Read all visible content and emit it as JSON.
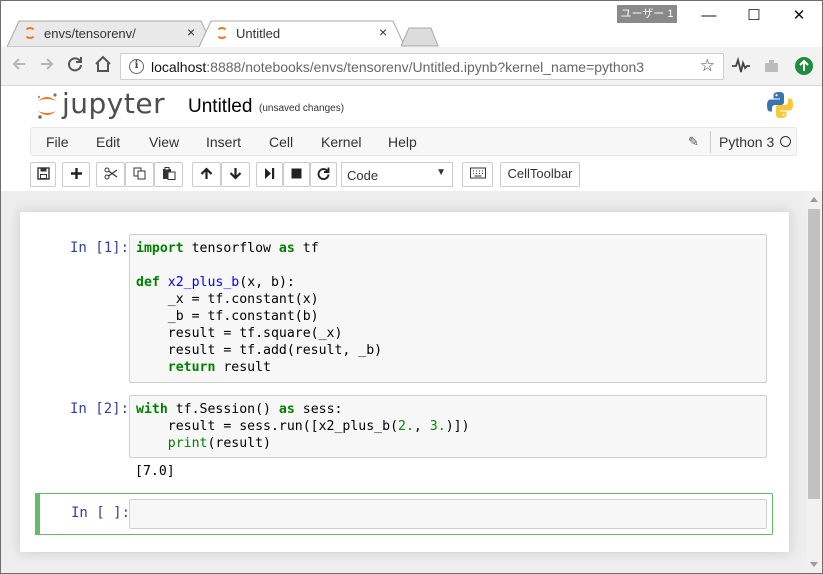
{
  "browser": {
    "tabs": [
      {
        "label": "envs/tensorenv/",
        "close": "×"
      },
      {
        "label": "Untitled",
        "close": "×"
      }
    ],
    "user_badge": "ユーザー 1",
    "window_controls": {
      "minimize": "—",
      "maximize": "☐",
      "close": "✕"
    },
    "address": {
      "host": "localhost",
      "rest": ":8888/notebooks/envs/tensorenv/Untitled.ipynb?kernel_name=python3"
    }
  },
  "jupyter": {
    "wordmark": "jupyter",
    "notebook_title": "Untitled",
    "save_status": "(unsaved changes)",
    "menu": [
      "File",
      "Edit",
      "View",
      "Insert",
      "Cell",
      "Kernel",
      "Help"
    ],
    "kernel_name": "Python 3",
    "toolbar": {
      "cell_type": "Code",
      "celltoolbar_label": "CellToolbar"
    }
  },
  "cells": [
    {
      "prompt": "In [1]:"
    },
    {
      "prompt": "In [2]:",
      "output": "[7.0]"
    },
    {
      "prompt": "In [ ]:"
    }
  ],
  "code_text": {
    "c1_l1_a": "import",
    "c1_l1_b": " tensorflow ",
    "c1_l1_c": "as",
    "c1_l1_d": " tf",
    "c1_l3_a": "def",
    "c1_l3_b": "x2_plus_b",
    "c1_l3_c": "(x, b):",
    "c1_l4": "    _x = tf.constant(x)",
    "c1_l5": "    _b = tf.constant(b)",
    "c1_l6": "    result = tf.square(_x)",
    "c1_l7": "    result = tf.add(result, _b)",
    "c1_l8_a": "return",
    "c1_l8_b": " result",
    "c2_l1_a": "with",
    "c2_l1_b": " tf.Session() ",
    "c2_l1_c": "as",
    "c2_l1_d": " sess:",
    "c2_l2_a": "    result = sess.run([x2_plus_b(",
    "c2_l2_b": "2.",
    "c2_l2_c": ", ",
    "c2_l2_d": "3.",
    "c2_l2_e": ")])",
    "c2_l3_a": "print",
    "c2_l3_b": "(result)"
  },
  "colors": {
    "jupyter_orange": "#f37626",
    "prompt_blue": "#303f9f",
    "keyword_green": "#008000",
    "function_blue": "#0000ff",
    "edit_mode_green": "#66bb6a"
  },
  "icons": [
    "back-icon",
    "forward-icon",
    "reload-icon",
    "home-icon",
    "info-icon",
    "star-icon",
    "save-icon",
    "plus-icon",
    "cut-icon",
    "copy-icon",
    "paste-icon",
    "arrow-up-icon",
    "arrow-down-icon",
    "run-icon",
    "stop-icon",
    "restart-icon",
    "keyboard-icon",
    "pencil-icon",
    "kernel-idle-icon",
    "python-logo"
  ]
}
